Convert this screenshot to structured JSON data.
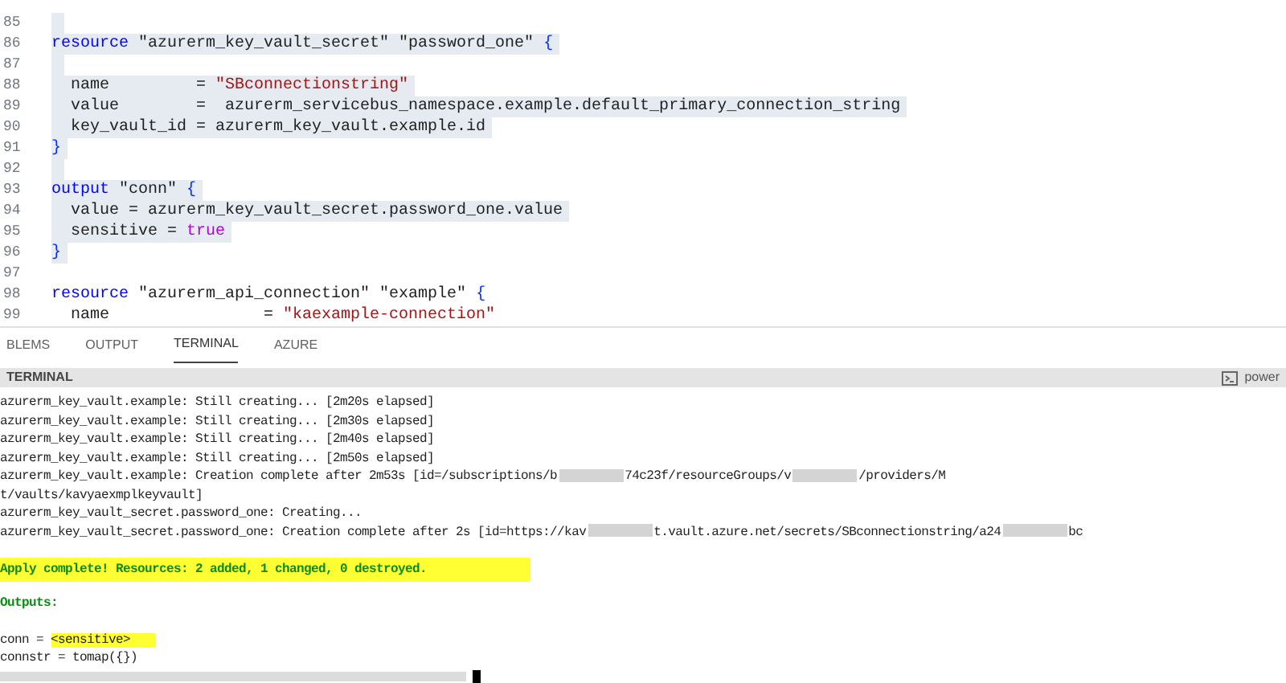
{
  "editor": {
    "lines": [
      {
        "number": "85",
        "selected": true
      },
      {
        "number": "86",
        "selected": true,
        "tokens": [
          {
            "kind": "keyword",
            "text": "resource "
          },
          {
            "kind": "plain",
            "text": "\"azurerm_key_vault_secret\" \"password_one\" "
          },
          {
            "kind": "brace",
            "text": "{"
          }
        ]
      },
      {
        "number": "87",
        "selected": true
      },
      {
        "number": "88",
        "selected": true,
        "tokens": [
          {
            "kind": "plain",
            "text": "  name         = "
          },
          {
            "kind": "string",
            "text": "\"SBconnectionstring\""
          }
        ]
      },
      {
        "number": "89",
        "selected": true,
        "tokens": [
          {
            "kind": "plain",
            "text": "  value        =  azurerm_servicebus_namespace.example.default_primary_connection_string"
          }
        ]
      },
      {
        "number": "90",
        "selected": true,
        "tokens": [
          {
            "kind": "plain",
            "text": "  key_vault_id = azurerm_key_vault.example.id"
          }
        ]
      },
      {
        "number": "91",
        "selected": true,
        "tokens": [
          {
            "kind": "brace",
            "text": "}"
          }
        ]
      },
      {
        "number": "92",
        "selected": true
      },
      {
        "number": "93",
        "selected": true,
        "tokens": [
          {
            "kind": "keyword",
            "text": "output "
          },
          {
            "kind": "plain",
            "text": "\"conn\" "
          },
          {
            "kind": "brace",
            "text": "{"
          }
        ]
      },
      {
        "number": "94",
        "selected": true,
        "tokens": [
          {
            "kind": "plain",
            "text": "  value = azurerm_key_vault_secret.password_one.value"
          }
        ]
      },
      {
        "number": "95",
        "selected": true,
        "tokens": [
          {
            "kind": "plain",
            "text": "  sensitive = "
          },
          {
            "kind": "bool",
            "text": "true"
          }
        ]
      },
      {
        "number": "96",
        "selected": true,
        "tokens": [
          {
            "kind": "brace",
            "text": "}"
          }
        ]
      },
      {
        "number": "97",
        "selected": false
      },
      {
        "number": "98",
        "selected": false,
        "tokens": [
          {
            "kind": "keyword",
            "text": "resource "
          },
          {
            "kind": "plain",
            "text": "\"azurerm_api_connection\" \"example\" "
          },
          {
            "kind": "brace",
            "text": "{"
          }
        ]
      },
      {
        "number": "99",
        "selected": false,
        "tokens": [
          {
            "kind": "plain",
            "text": "  name                = "
          },
          {
            "kind": "string",
            "text": "\"kaexample-connection\""
          }
        ]
      }
    ]
  },
  "panel_tabs": [
    {
      "label": "BLEMS",
      "selected": false
    },
    {
      "label": "OUTPUT",
      "selected": false
    },
    {
      "label": "TERMINAL",
      "selected": true
    },
    {
      "label": "AZURE",
      "selected": false
    }
  ],
  "terminal": {
    "title": "TERMINAL",
    "shell": "power",
    "lines": [
      {
        "kind": "normal",
        "segments": [
          {
            "kind": "text",
            "text": "azurerm_key_vault.example: Still creating... [2m20s elapsed]"
          }
        ]
      },
      {
        "kind": "normal",
        "segments": [
          {
            "kind": "text",
            "text": "azurerm_key_vault.example: Still creating... [2m30s elapsed]"
          }
        ]
      },
      {
        "kind": "normal",
        "segments": [
          {
            "kind": "text",
            "text": "azurerm_key_vault.example: Still creating... [2m40s elapsed]"
          }
        ]
      },
      {
        "kind": "normal",
        "segments": [
          {
            "kind": "text",
            "text": "azurerm_key_vault.example: Still creating... [2m50s elapsed]"
          }
        ]
      },
      {
        "kind": "normal",
        "segments": [
          {
            "kind": "text",
            "text": "azurerm_key_vault.example: Creation complete after 2m53s [id=/subscriptions/b"
          },
          {
            "kind": "redacted"
          },
          {
            "kind": "text",
            "text": "74c23f/resourceGroups/v"
          },
          {
            "kind": "redacted"
          },
          {
            "kind": "text",
            "text": "/providers/M"
          }
        ]
      },
      {
        "kind": "normal",
        "segments": [
          {
            "kind": "text",
            "text": "t/vaults/kavyaexmplkeyvault]"
          }
        ]
      },
      {
        "kind": "normal",
        "segments": [
          {
            "kind": "text",
            "text": "azurerm_key_vault_secret.password_one: Creating..."
          }
        ]
      },
      {
        "kind": "normal",
        "segments": [
          {
            "kind": "text",
            "text": "azurerm_key_vault_secret.password_one: Creation complete after 2s [id=https://kav"
          },
          {
            "kind": "redacted"
          },
          {
            "kind": "text",
            "text": "t.vault.azure.net/secrets/SBconnectionstring/a24"
          },
          {
            "kind": "redacted"
          },
          {
            "kind": "text",
            "text": "bc"
          }
        ]
      },
      {
        "kind": "blank"
      },
      {
        "kind": "success",
        "segments": [
          {
            "kind": "text",
            "text": "Apply complete! Resources: 2 added, 1 changed, 0 destroyed."
          }
        ]
      },
      {
        "kind": "blank"
      },
      {
        "kind": "heading",
        "segments": [
          {
            "kind": "text",
            "text": "Outputs:"
          }
        ]
      },
      {
        "kind": "blank"
      },
      {
        "kind": "output",
        "segments": [
          {
            "kind": "text",
            "text": "conn = "
          },
          {
            "kind": "marked",
            "text": "<sensitive>"
          }
        ]
      },
      {
        "kind": "normal",
        "segments": [
          {
            "kind": "text",
            "text": "connstr = tomap({})"
          }
        ]
      },
      {
        "kind": "prompt"
      }
    ]
  }
}
